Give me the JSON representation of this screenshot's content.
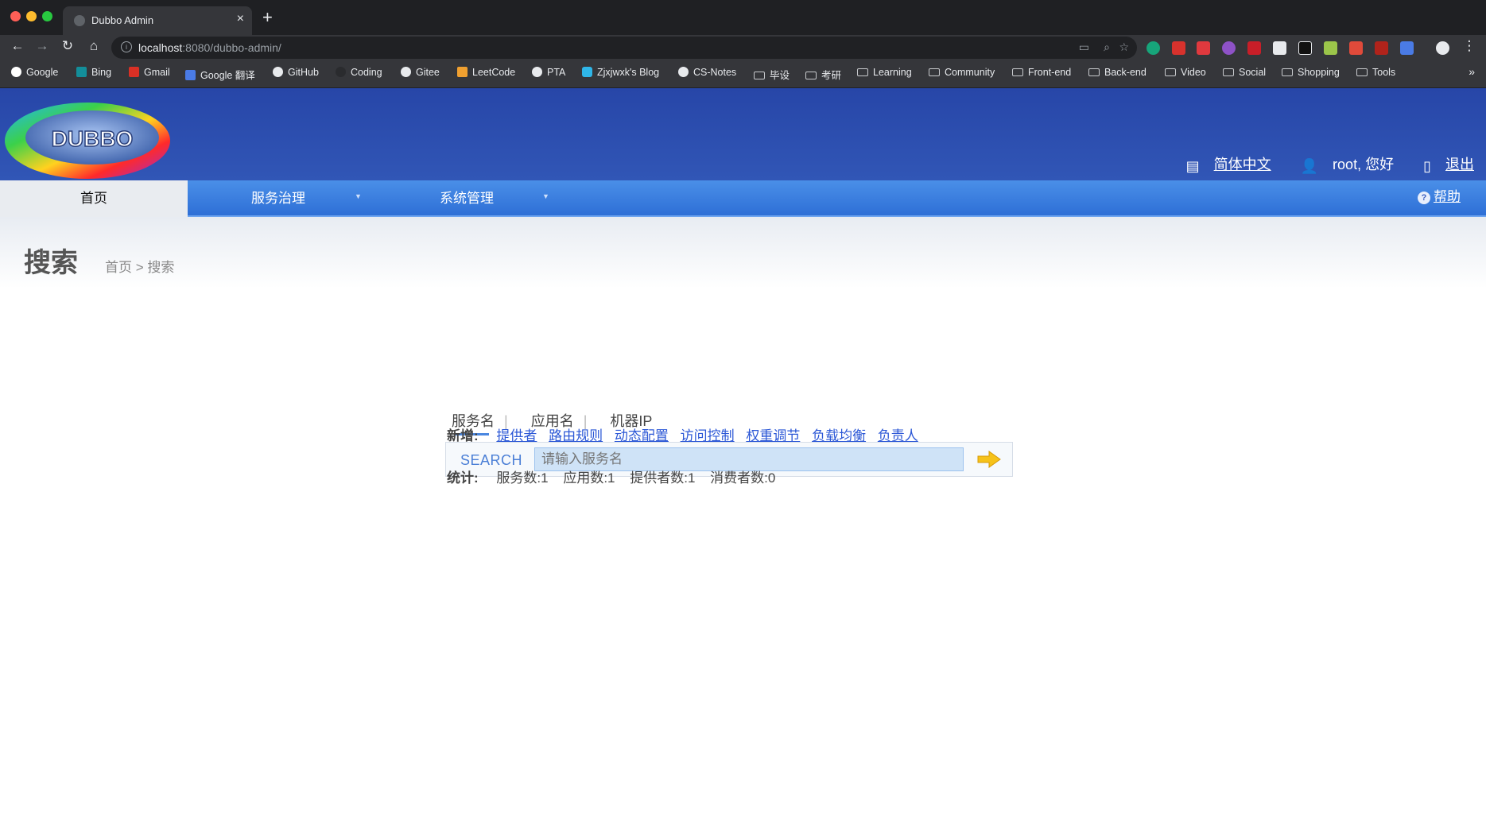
{
  "browser": {
    "tab_title": "Dubbo Admin",
    "tab_close": "×",
    "new_tab": "+",
    "url_host": "localhost",
    "url_rest": ":8080/dubbo-admin/",
    "bookmarks": [
      "Google",
      "Bing",
      "Gmail",
      "Google 翻译",
      "GitHub",
      "Coding",
      "Gitee",
      "LeetCode",
      "PTA",
      "Zjxjwxk's Blog",
      "CS-Notes"
    ],
    "bookmark_folders": [
      "毕设",
      "考研",
      "Learning",
      "Community",
      "Front-end",
      "Back-end",
      "Video",
      "Social",
      "Shopping",
      "Tools"
    ],
    "more": "»"
  },
  "header": {
    "logo_text": "DUBBO",
    "language": "简体中文",
    "greeting": "root, 您好",
    "logout": "退出"
  },
  "nav": {
    "home": "首页",
    "service_governance": "服务治理",
    "system_management": "系统管理",
    "help": "帮助"
  },
  "page": {
    "title": "搜索",
    "breadcrumb": "首页 > 搜索"
  },
  "search": {
    "tabs": [
      "服务名",
      "应用名",
      "机器IP"
    ],
    "label": "SEARCH",
    "placeholder": "请输入服务名"
  },
  "add_new": {
    "label": "新增:",
    "links": [
      "提供者",
      "路由规则",
      "动态配置",
      "访问控制",
      "权重调节",
      "负载均衡",
      "负责人"
    ]
  },
  "stats": {
    "label": "统计:",
    "items": [
      "服务数:1",
      "应用数:1",
      "提供者数:1",
      "消费者数:0"
    ]
  }
}
